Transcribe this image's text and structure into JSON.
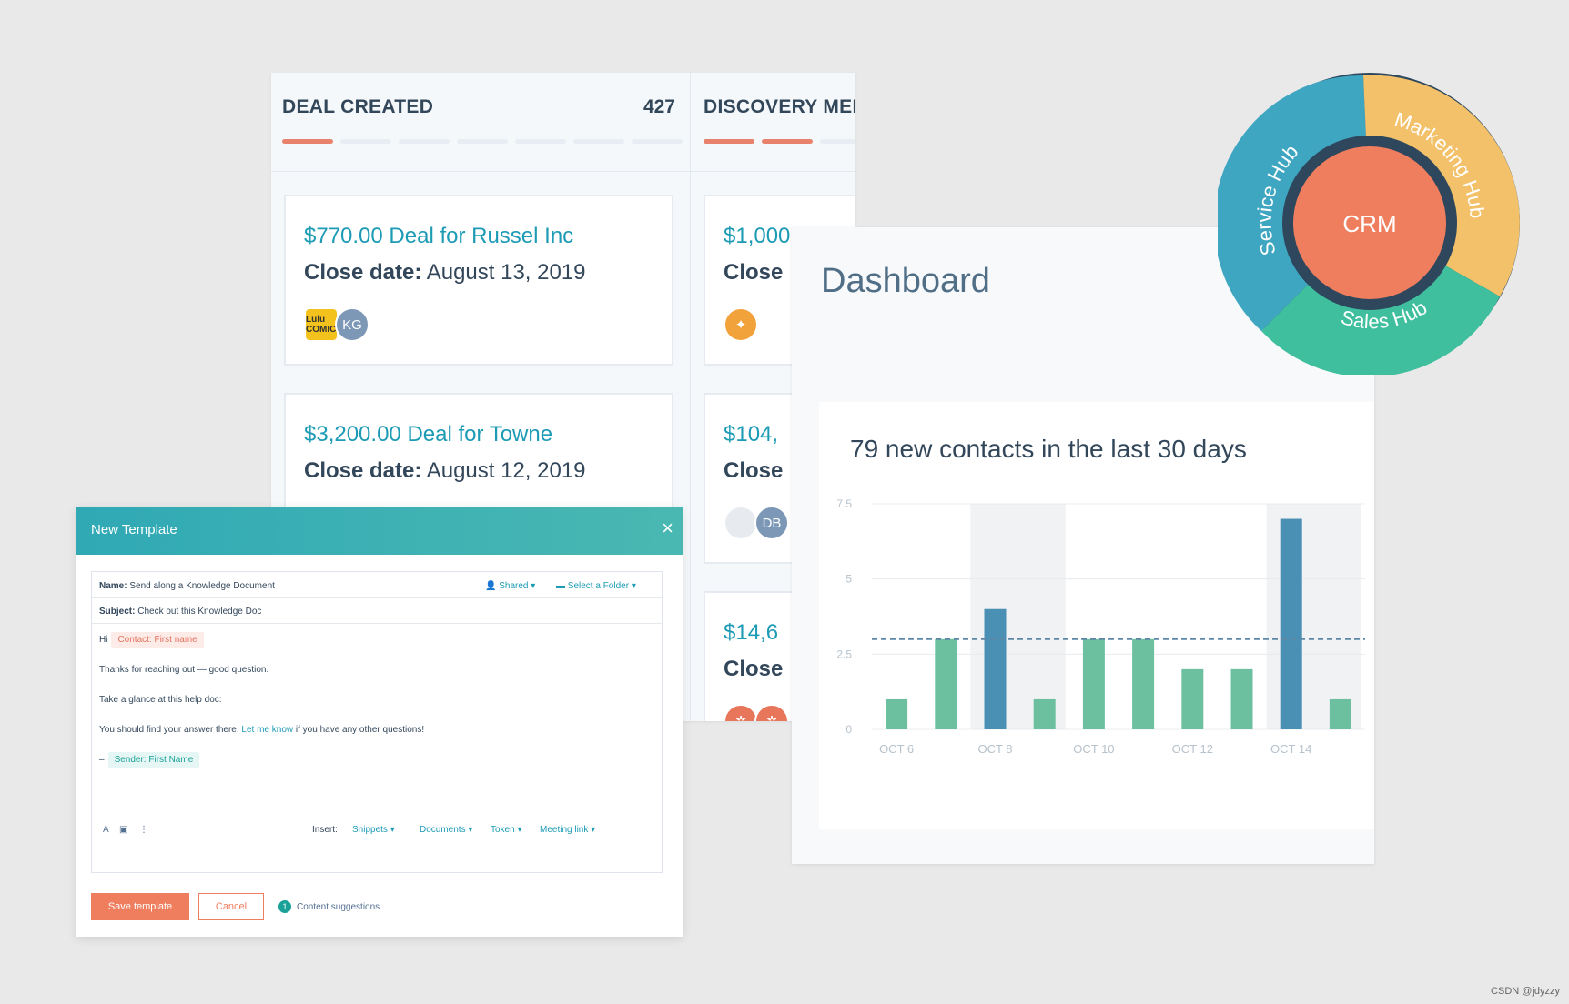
{
  "pipeline": {
    "columns": [
      {
        "title": "DEAL CREATED",
        "count": "427",
        "cards": [
          {
            "title": "$770.00 Deal for Russel Inc",
            "close_label": "Close date:",
            "close_value": " August 13, 2019",
            "avatar_text": "KG",
            "logo_text": "Lulu COMIC"
          },
          {
            "title": "$3,200.00 Deal for Towne",
            "close_label": "Close date:",
            "close_value": " August 12, 2019"
          }
        ]
      },
      {
        "title": "DISCOVERY MEE",
        "cards": [
          {
            "title": "$1,000",
            "close_label": "Close"
          },
          {
            "title": "$104,",
            "close_label": "Close",
            "avatar_text": "DB"
          },
          {
            "title": "$14,6",
            "close_label": "Close"
          }
        ]
      }
    ]
  },
  "dashboard": {
    "title": "Dashboard"
  },
  "chart_data": {
    "type": "bar",
    "title": "79 new contacts in the last 30 days",
    "categories": [
      "",
      "",
      "",
      "",
      "",
      "",
      "",
      "",
      "",
      ""
    ],
    "x_tick_labels": [
      "OCT 6",
      "OCT 8",
      "OCT 10",
      "OCT 12",
      "OCT 14"
    ],
    "values": [
      1,
      3,
      4,
      1,
      3,
      3,
      2,
      2,
      7,
      1
    ],
    "highlighted_indices": [
      2,
      8
    ],
    "average_line": 3,
    "ylim": [
      0,
      7.5
    ],
    "y_ticks": [
      "0",
      "2.5",
      "5",
      "7.5"
    ],
    "colors": {
      "bar": "#6cc0a0",
      "highlight": "#4a90b5",
      "average": "#5d87a6"
    }
  },
  "crm": {
    "center": "CRM",
    "segments": [
      "Service Hub",
      "Marketing Hub",
      "Sales Hub"
    ],
    "colors": {
      "service": "#3fa6c2",
      "marketing": "#f3c16a",
      "sales": "#3fbf9e",
      "center": "#ef7e5e",
      "ring": "#2e475d"
    }
  },
  "template": {
    "title": "New Template",
    "close": "×",
    "name_label": "Name:",
    "name_value": "Send along a Knowledge Document",
    "shared": "Shared ▾",
    "folder": "Select a Folder ▾",
    "subject_label": "Subject:",
    "subject_value": "Check out this Knowledge Doc",
    "greeting": "Hi",
    "contact_token": "Contact: First name",
    "line1": "Thanks for reaching out — good question.",
    "line2": "Take a glance at this help doc:",
    "line3_a": "You should find your answer there.",
    "line3_link": "Let me know",
    "line3_b": "if you have any other questions!",
    "dash": "–",
    "sender_token": "Sender: First Name",
    "insert_label": "Insert:",
    "insert_items": [
      "Snippets ▾",
      "Documents ▾",
      "Token ▾",
      "Meeting link ▾"
    ],
    "tools": [
      "A",
      "▣",
      "⋮"
    ],
    "save_label": "Save template",
    "cancel_label": "Cancel",
    "suggestions": "Content suggestions",
    "suggestions_count": "1"
  },
  "watermark": "CSDN @jdyzzy"
}
